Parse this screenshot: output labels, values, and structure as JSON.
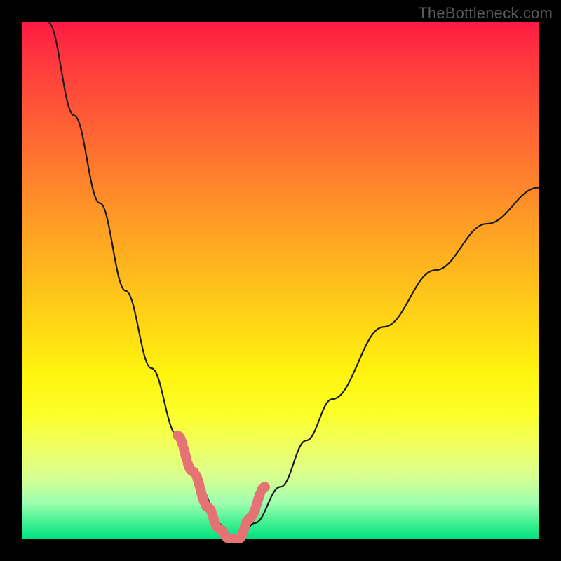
{
  "watermark": "TheBottleneck.com",
  "chart_data": {
    "type": "line",
    "title": "",
    "xlabel": "",
    "ylabel": "",
    "xlim": [
      0,
      100
    ],
    "ylim": [
      0,
      100
    ],
    "background_gradient": {
      "orientation": "vertical",
      "stops": [
        {
          "pos": 0,
          "color": "#ff1a44"
        },
        {
          "pos": 38,
          "color": "#ff9a26"
        },
        {
          "pos": 68,
          "color": "#fff40e"
        },
        {
          "pos": 100,
          "color": "#00e080"
        }
      ]
    },
    "series": [
      {
        "name": "bottleneck-curve",
        "x": [
          5,
          10,
          15,
          20,
          25,
          30,
          35,
          38,
          40,
          42,
          45,
          50,
          55,
          60,
          70,
          80,
          90,
          100
        ],
        "y": [
          100,
          82,
          65,
          48,
          33,
          20,
          9,
          3,
          0,
          0,
          3,
          10,
          19,
          27,
          41,
          52,
          61,
          68
        ]
      }
    ],
    "highlighted_range": {
      "comment": "pink dashed overlay near valley",
      "x": [
        30,
        33,
        36,
        38,
        40,
        42,
        44,
        47
      ],
      "y": [
        20,
        13,
        6,
        2,
        0,
        0,
        4,
        10
      ]
    },
    "annotations": []
  }
}
